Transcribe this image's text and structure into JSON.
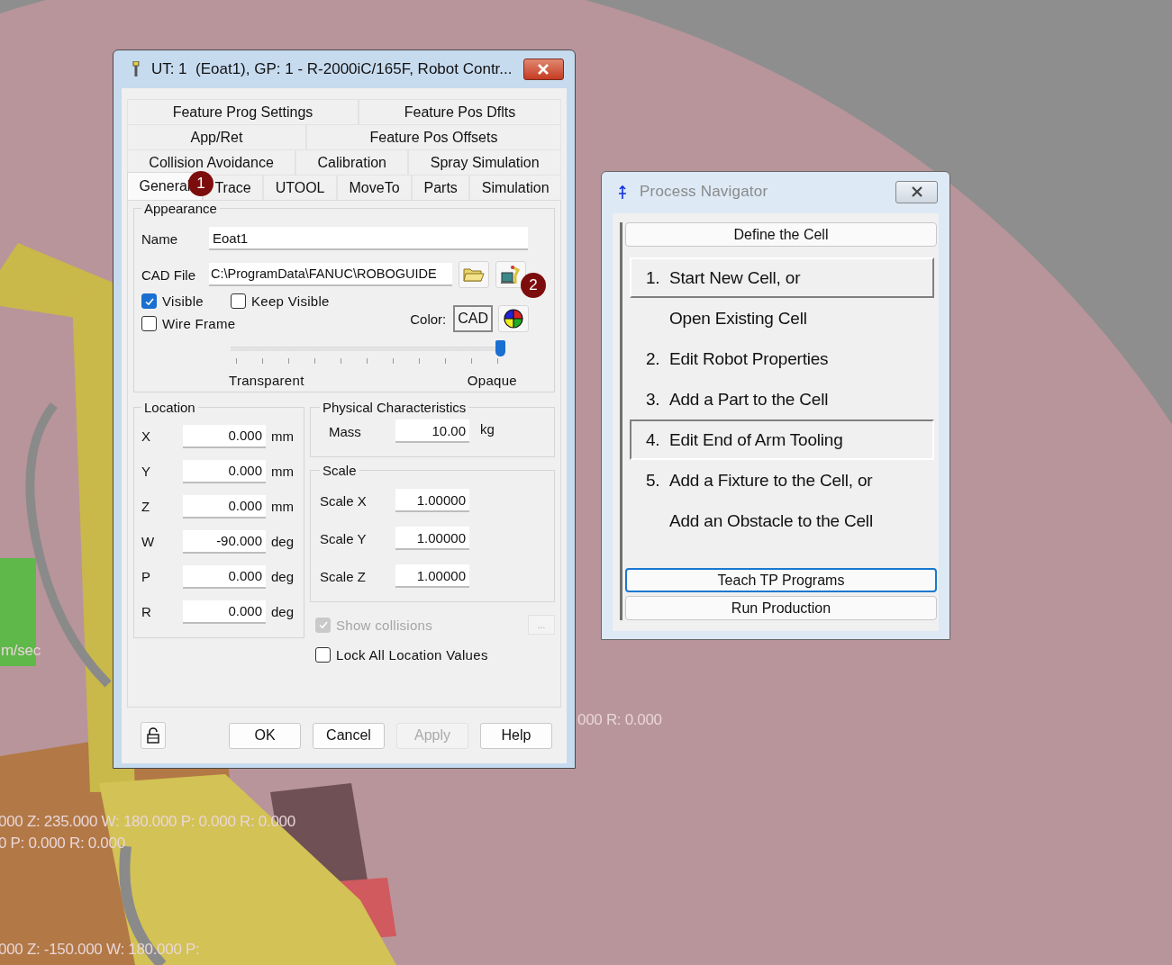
{
  "viewport_labels": [
    {
      "text": "m/sec"
    },
    {
      "text": "000 R: 0.000"
    },
    {
      "text": "000 Z: 235.000 W: 180.000 P: 0.000 R: 0.000"
    },
    {
      "text": "0 P: 0.000 R: 0.000"
    },
    {
      "text": "000 Z: -150.000 W: 180.000 P:"
    }
  ],
  "dialog": {
    "title": "UT: 1  (Eoat1), GP: 1 - R-2000iC/165F, Robot Contr...",
    "tab_rows": [
      [
        {
          "label": "Feature Prog Settings",
          "selected": false
        },
        {
          "label": "Feature Pos Dflts",
          "selected": false
        }
      ],
      [
        {
          "label": "App/Ret",
          "selected": false
        },
        {
          "label": "Feature Pos Offsets",
          "selected": false
        }
      ],
      [
        {
          "label": "Collision Avoidance",
          "selected": false
        },
        {
          "label": "Calibration",
          "selected": false
        },
        {
          "label": "Spray Simulation",
          "selected": false
        }
      ],
      [
        {
          "label": "General",
          "selected": true
        },
        {
          "label": "Trace",
          "selected": false
        },
        {
          "label": "UTOOL",
          "selected": false
        },
        {
          "label": "MoveTo",
          "selected": false
        },
        {
          "label": "Parts",
          "selected": false
        },
        {
          "label": "Simulation",
          "selected": false
        }
      ]
    ],
    "appearance": {
      "title": "Appearance",
      "name_label": "Name",
      "name_value": "Eoat1",
      "cad_label": "CAD File",
      "cad_value": "C:\\ProgramData\\FANUC\\ROBOGUIDE",
      "checkboxes": [
        {
          "label": "Visible",
          "checked": true
        },
        {
          "label": "Keep Visible",
          "checked": false
        },
        {
          "label": "Wire Frame",
          "checked": false
        }
      ],
      "color_label": "Color:",
      "color_button": "CAD",
      "opacity": {
        "level": 0.99,
        "min_label": "Transparent",
        "max_label": "Opaque"
      }
    },
    "location": {
      "title": "Location",
      "rows": [
        {
          "axis": "X",
          "value": "0.000",
          "unit": "mm"
        },
        {
          "axis": "Y",
          "value": "0.000",
          "unit": "mm"
        },
        {
          "axis": "Z",
          "value": "0.000",
          "unit": "mm"
        },
        {
          "axis": "W",
          "value": "-90.000",
          "unit": "deg"
        },
        {
          "axis": "P",
          "value": "0.000",
          "unit": "deg"
        },
        {
          "axis": "R",
          "value": "0.000",
          "unit": "deg"
        }
      ]
    },
    "physical": {
      "title": "Physical Characteristics",
      "mass_label": "Mass",
      "mass_value": "10.00",
      "mass_unit": "kg"
    },
    "scale": {
      "title": "Scale",
      "rows": [
        {
          "label": "Scale X",
          "value": "1.00000"
        },
        {
          "label": "Scale Y",
          "value": "1.00000"
        },
        {
          "label": "Scale Z",
          "value": "1.00000"
        }
      ]
    },
    "show_collisions": {
      "label": "Show collisions",
      "checked": true,
      "disabled": true
    },
    "more_button": {
      "label": "...",
      "disabled": true
    },
    "lock_values": {
      "label": "Lock All Location Values",
      "checked": false
    },
    "buttons": [
      {
        "label": "OK",
        "disabled": false
      },
      {
        "label": "Cancel",
        "disabled": false
      },
      {
        "label": "Apply",
        "disabled": true
      },
      {
        "label": "Help",
        "disabled": false
      }
    ],
    "callouts": [
      {
        "text": "1"
      },
      {
        "text": "2"
      }
    ]
  },
  "navigator": {
    "title": "Process Navigator",
    "top_buttons": [
      {
        "label": "Define the Cell",
        "focused": false
      }
    ],
    "steps": [
      {
        "number": "1.",
        "label": "Start New Cell, or",
        "raised": true,
        "pressed": false
      },
      {
        "label": "Open Existing Cell",
        "raised": false,
        "pressed": false
      },
      {
        "number": "2.",
        "label": "Edit Robot Properties",
        "raised": false,
        "pressed": false
      },
      {
        "number": "3.",
        "label": "Add a Part to the Cell",
        "raised": false,
        "pressed": false
      },
      {
        "number": "4.",
        "label": "Edit End of Arm Tooling",
        "raised": false,
        "pressed": true
      },
      {
        "number": "5.",
        "label": "Add a Fixture to the Cell, or",
        "raised": false,
        "pressed": false
      },
      {
        "label": "Add an Obstacle to the Cell",
        "raised": false,
        "pressed": false
      }
    ],
    "bottom_buttons": [
      {
        "label": "Teach TP Programs",
        "focused": true
      },
      {
        "label": "Run Production",
        "focused": false
      }
    ]
  }
}
